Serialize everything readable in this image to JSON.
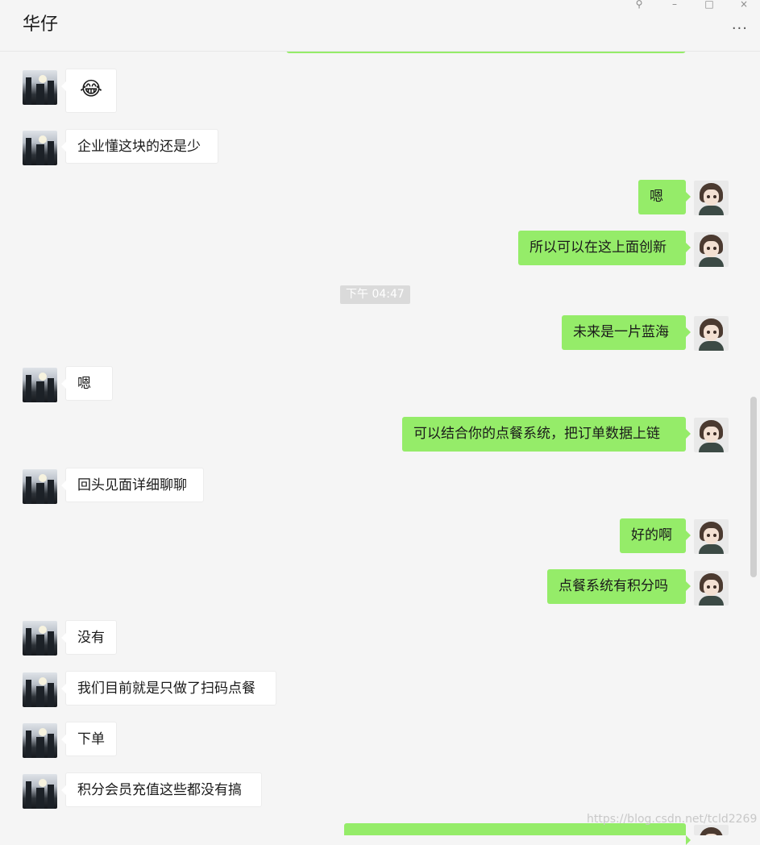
{
  "header": {
    "title": "华仔",
    "more_label": "···",
    "window_controls": {
      "pin": "⚲",
      "minimize": "–",
      "maximize": "□",
      "close": "×"
    }
  },
  "time_divider": "下午 04:47",
  "messages": [
    {
      "from": "them",
      "text": "😂",
      "kind": "emoji"
    },
    {
      "from": "them",
      "text": "企业懂这块的还是少"
    },
    {
      "from": "me",
      "text": "嗯"
    },
    {
      "from": "me",
      "text": "所以可以在这上面创新"
    },
    {
      "from": "me",
      "text": "未来是一片蓝海"
    },
    {
      "from": "them",
      "text": "嗯"
    },
    {
      "from": "me",
      "text": "可以结合你的点餐系统，把订单数据上链"
    },
    {
      "from": "them",
      "text": "回头见面详细聊聊"
    },
    {
      "from": "me",
      "text": "好的啊"
    },
    {
      "from": "me",
      "text": "点餐系统有积分吗"
    },
    {
      "from": "them",
      "text": "没有"
    },
    {
      "from": "them",
      "text": "我们目前就是只做了扫码点餐"
    },
    {
      "from": "them",
      "text": "下单"
    },
    {
      "from": "them",
      "text": "积分会员充值这些都没有搞"
    },
    {
      "from": "me",
      "text": ""
    }
  ],
  "watermark": "https://blog.csdn.net/tcld2269",
  "icons": {
    "them_avatar": "city-skyline-avatar",
    "me_avatar": "anime-boy-avatar"
  }
}
